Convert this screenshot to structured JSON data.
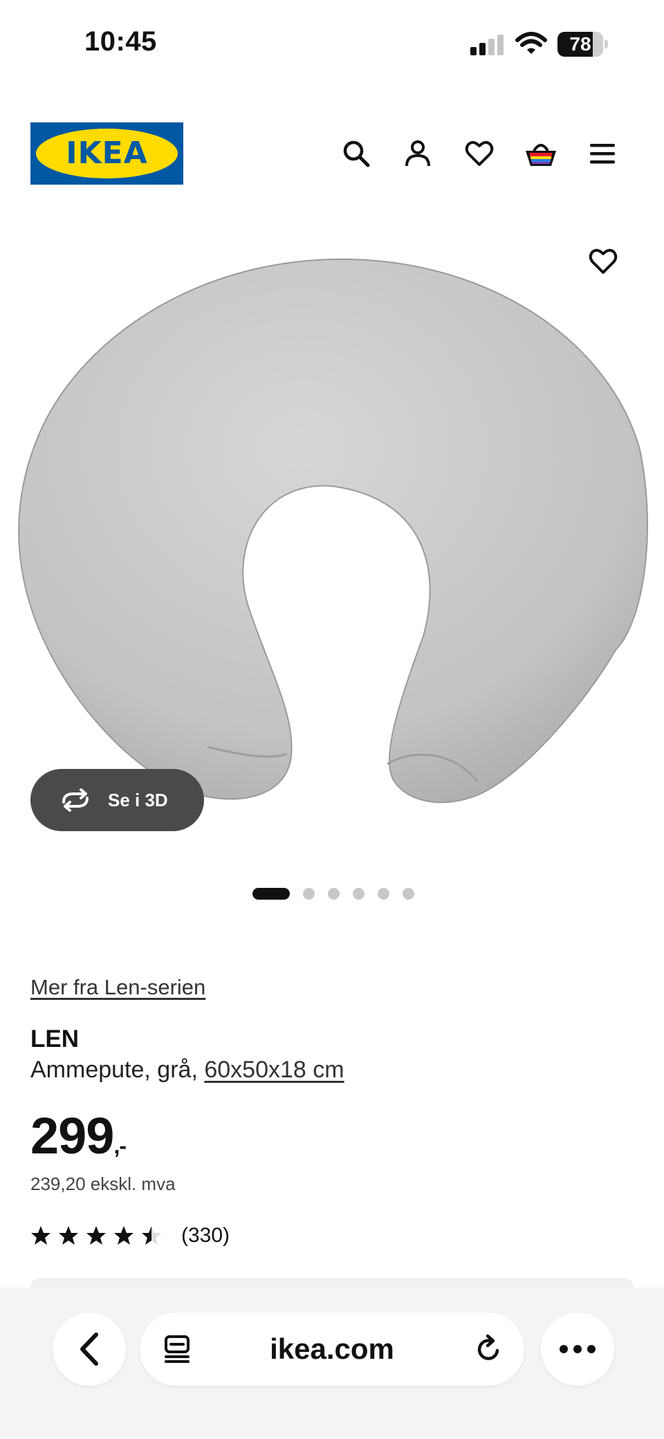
{
  "status_bar": {
    "time": "10:45",
    "battery": "78",
    "battery_level": 0.78
  },
  "header": {
    "logo_text": "IKEA",
    "icons": [
      "search-icon",
      "account-icon",
      "heart-icon",
      "basket-icon",
      "menu-icon"
    ]
  },
  "media": {
    "view3d_label": "Se i 3D",
    "image_count": 6,
    "active_image": 1
  },
  "product": {
    "series_link": "Mer fra Len-serien",
    "name": "LEN",
    "description": "Ammepute, grå, ",
    "size_link": "60x50x18 cm",
    "price": "299",
    "price_suffix": ",-",
    "price_excl_vat": "239,20 ekskl. mva",
    "rating": 4.5,
    "rating_max": 5,
    "review_count": "(330)"
  },
  "browser": {
    "url": "ikea.com"
  },
  "colors": {
    "ikea_blue": "#0058a3",
    "ikea_yellow": "#ffdb00",
    "pillow_gray": "#c9c9c9"
  }
}
